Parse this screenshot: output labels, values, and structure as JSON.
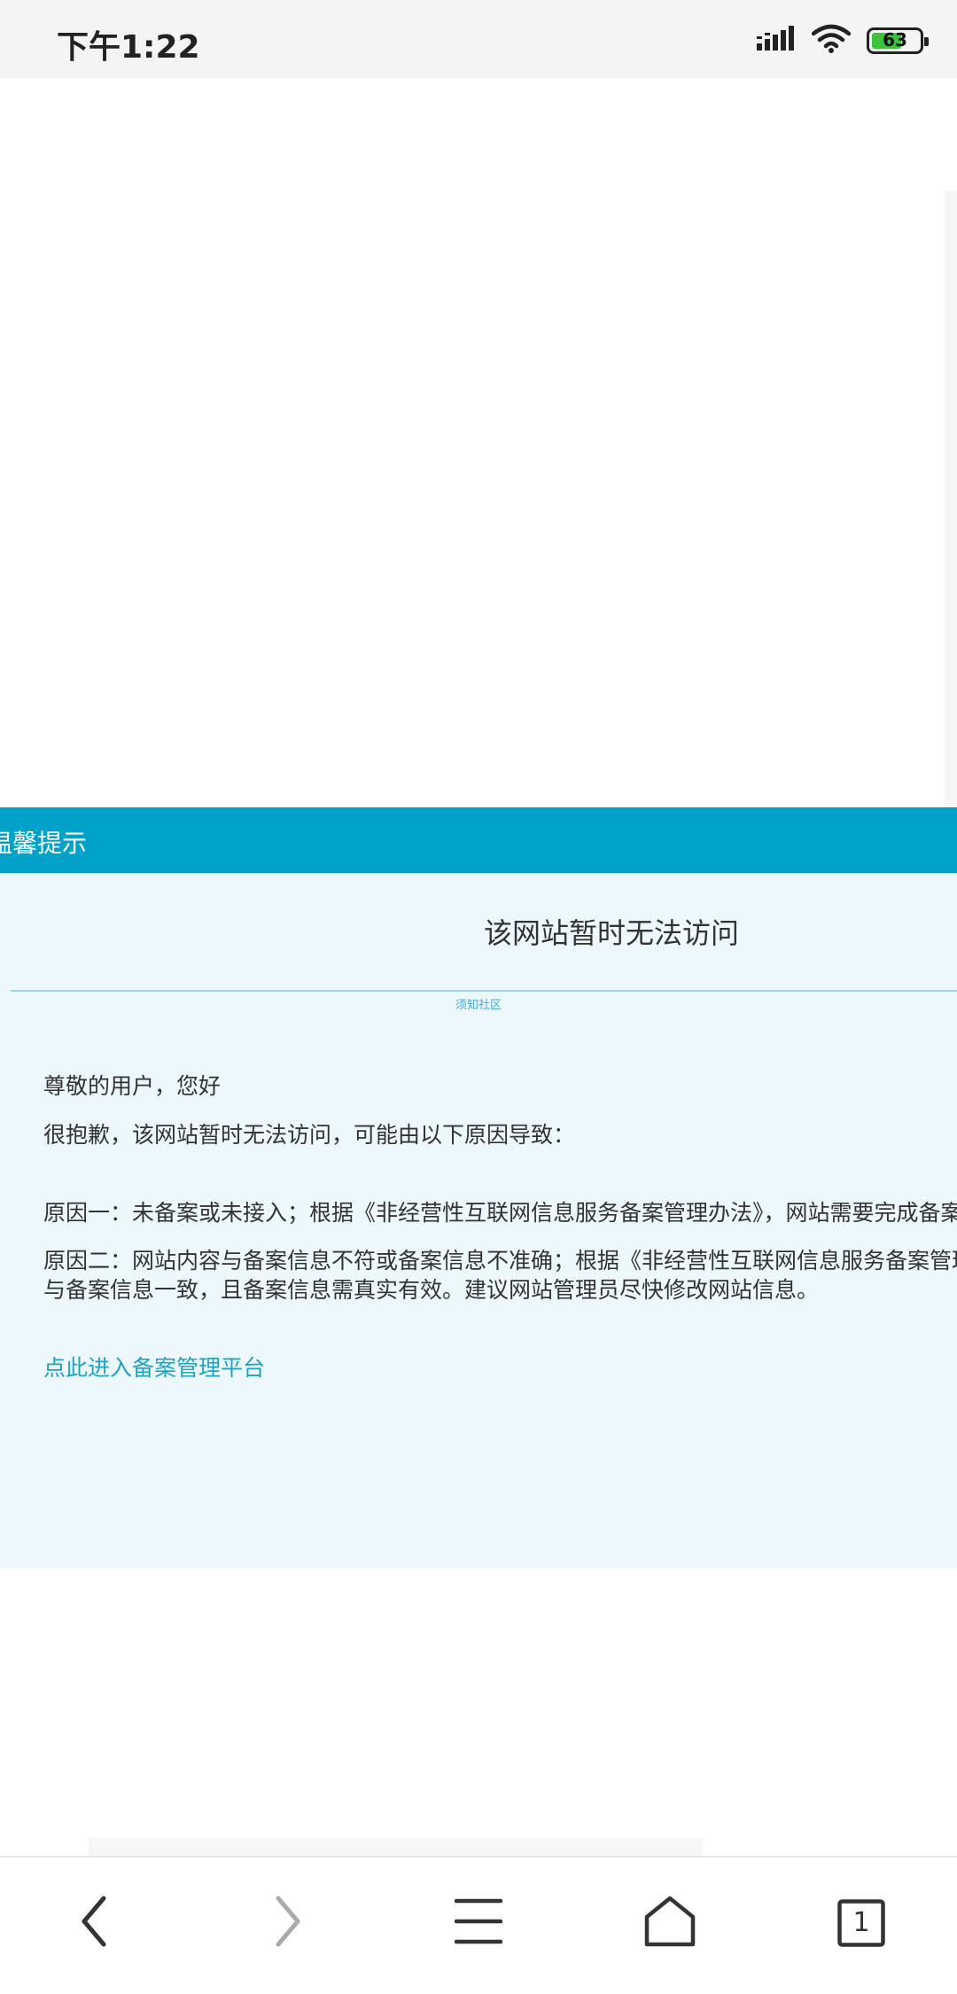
{
  "status_bar": {
    "time": "下午1:22",
    "battery_level": "63",
    "battery_fraction": 0.63,
    "icons": [
      "signal-icon",
      "wifi-icon",
      "battery-icon"
    ]
  },
  "notice": {
    "header": "温馨提示",
    "title": "该网站暂时无法访问",
    "watermark": "须知社区",
    "greeting": "尊敬的用户，您好",
    "apology": "很抱歉，该网站暂时无法访问，可能由以下原因导致：",
    "reason1": "原因一：未备案或未接入；根据《非经营性互联网信息服务备案管理办法》，网站需要完成备案或",
    "reason2_line1": "原因二：网站内容与备案信息不符或备案信息不准确；根据《非经营性互联网信息服务备案管理办",
    "reason2_line2": "与备案信息一致，且备案信息需真实有效。建议网站管理员尽快修改网站信息。",
    "link": "点此进入备案管理平台"
  },
  "bottom_nav": {
    "tab_count": "1",
    "buttons": [
      "back-icon",
      "forward-icon",
      "menu-icon",
      "home-icon",
      "tabs-icon"
    ]
  },
  "colors": {
    "header_bg": "#00a2c9",
    "notice_bg": "#ecf8fc",
    "link": "#1ea3c6",
    "battery_fill": "#3cc23c"
  }
}
